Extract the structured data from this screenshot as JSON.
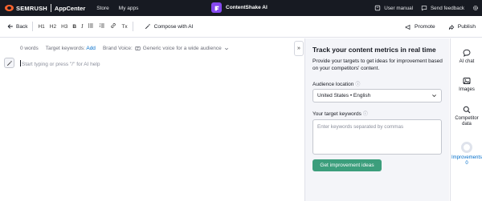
{
  "topbar": {
    "brand": "SEMRUSH",
    "appcenter": "AppCenter",
    "nav": [
      "Store",
      "My apps"
    ],
    "app_title": "ContentShake AI",
    "user_manual": "User manual",
    "send_feedback": "Send feedback",
    "app_icon_color": "#8649f1"
  },
  "toolbar": {
    "back": "Back",
    "format": {
      "h1": "H1",
      "h2": "H2",
      "h3": "H3",
      "bold": "B",
      "italic": "I",
      "clear": "Tx"
    },
    "compose": "Compose with AI",
    "promote": "Promote",
    "publish": "Publish"
  },
  "editor": {
    "word_count": "0 words",
    "target_keywords_label": "Target keywords:",
    "target_keywords_link": "Add",
    "brand_voice_label": "Brand Voice:",
    "brand_voice_value": "Generic voice for a wide audience",
    "placeholder": "Start typing or press \"/\" for AI help"
  },
  "panel": {
    "collapse_glyph": "»",
    "title": "Track your content metrics in real time",
    "description": "Provide your targets to get ideas for improvement based on your competitors' content.",
    "audience_label": "Audience location",
    "audience_value": "United States • English",
    "keywords_label": "Your target keywords",
    "keywords_placeholder": "Enter keywords separated by commas",
    "cta": "Get improvement ideas",
    "cta_color": "#3c9e7c"
  },
  "rail": {
    "ai_chat": "AI chat",
    "images": "Images",
    "competitor_data_line1": "Competitor",
    "competitor_data_line2": "data",
    "improvements": "Improvements",
    "improvements_count": "0",
    "active_color": "#006dca"
  }
}
